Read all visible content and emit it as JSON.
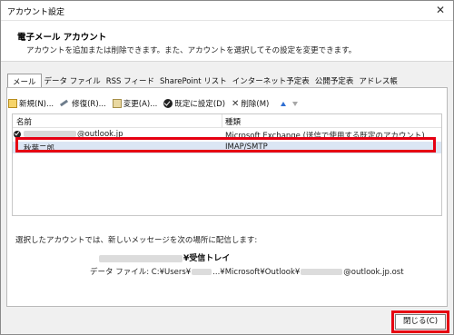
{
  "window": {
    "title": "アカウント設定",
    "close_glyph": "✕"
  },
  "header": {
    "heading": "電子メール アカウント",
    "description": "アカウントを追加または削除できます。また、アカウントを選択してその設定を変更できます。"
  },
  "tabs": [
    {
      "label": "メール",
      "active": true
    },
    {
      "label": "データ ファイル"
    },
    {
      "label": "RSS フィード"
    },
    {
      "label": "SharePoint リスト"
    },
    {
      "label": "インターネット予定表"
    },
    {
      "label": "公開予定表"
    },
    {
      "label": "アドレス帳"
    }
  ],
  "toolbar": {
    "new_label": "新規(N)...",
    "repair_label": "修復(R)...",
    "change_label": "変更(A)...",
    "default_label": "既定に設定(D)",
    "delete_label": "削除(M)",
    "delete_glyph": "✕"
  },
  "accounts": {
    "col_name": "名前",
    "col_type": "種類",
    "rows": [
      {
        "name_suffix": "@outlook.jp",
        "type": "Microsoft Exchange (送信で使用する既定のアカウント)",
        "default": true
      },
      {
        "name": "秋葉二郎",
        "type": "IMAP/SMTP",
        "selected": true
      }
    ]
  },
  "delivery": {
    "info": "選択したアカウントでは、新しいメッセージを次の場所に配信します:",
    "inbox_suffix": "¥受信トレイ",
    "datafile_prefix": "データ ファイル: C:¥Users¥",
    "datafile_middle": "...¥Microsoft¥Outlook¥",
    "datafile_suffix": "@outlook.jp.ost"
  },
  "footer": {
    "close_label": "閉じる(C)"
  },
  "colors": {
    "highlight_red": "#e60012",
    "selected_row": "#dbe6f4",
    "arrow_up_blue": "#2f6fd2"
  }
}
